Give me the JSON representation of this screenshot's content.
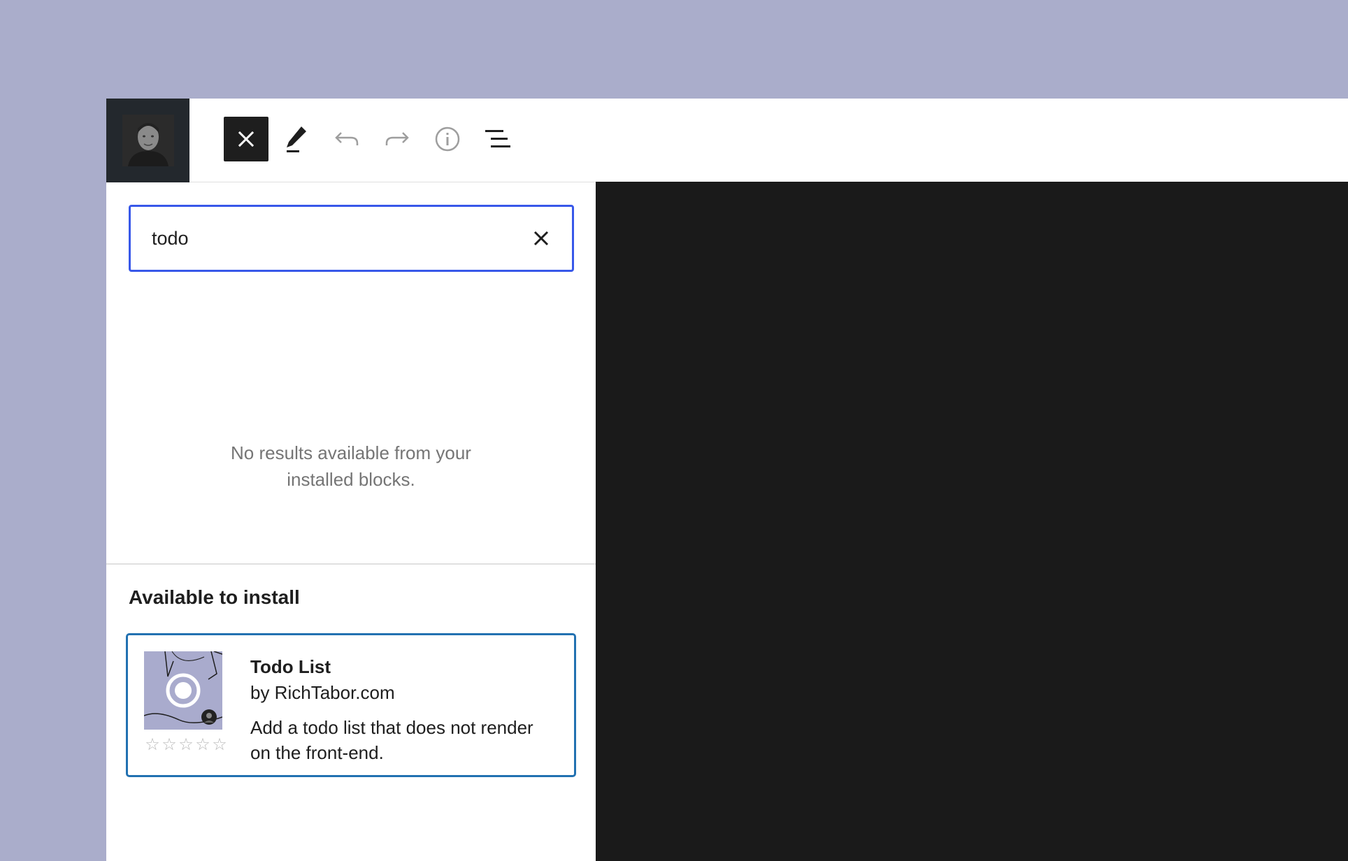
{
  "header": {
    "site_logo_alt": "Site icon",
    "tools": [
      {
        "name": "close",
        "icon": "close-icon"
      },
      {
        "name": "edit",
        "icon": "pencil-icon"
      },
      {
        "name": "undo",
        "icon": "undo-icon"
      },
      {
        "name": "redo",
        "icon": "redo-icon"
      },
      {
        "name": "details",
        "icon": "info-icon"
      },
      {
        "name": "list-view",
        "icon": "list-view-icon"
      }
    ]
  },
  "inserter": {
    "search": {
      "value": "todo",
      "placeholder": "Search"
    },
    "no_results_line1": "No results available from your",
    "no_results_line2": "installed blocks.",
    "section_title": "Available to install",
    "block": {
      "title": "Todo List",
      "author": "by RichTabor.com",
      "description": "Add a todo list that does not render on the front-end.",
      "rating": 0,
      "rating_max": 5
    }
  },
  "colors": {
    "background": "#aaadcb",
    "accent": "#3858e9",
    "card_border": "#2271b1",
    "canvas": "#1a1a1a",
    "logo_bg": "#23282d"
  }
}
